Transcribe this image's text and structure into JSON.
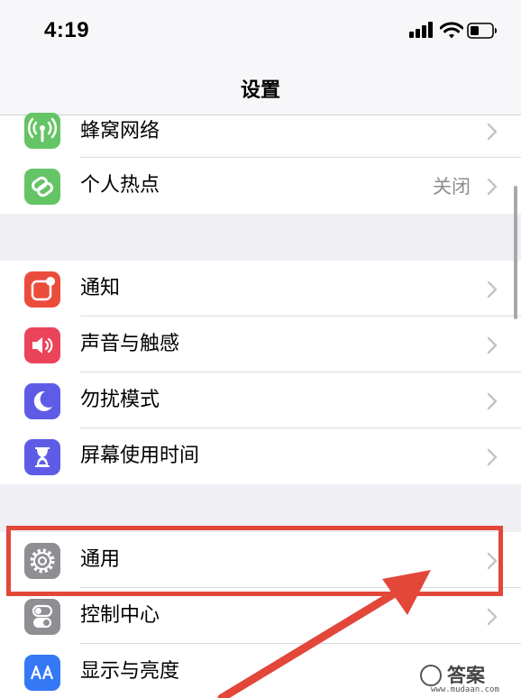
{
  "status_bar": {
    "time": "4:19"
  },
  "nav": {
    "title": "设置"
  },
  "groups": {
    "network": [
      {
        "label": "蜂窝网络",
        "icon": "cellular-antenna-icon",
        "color": "#65c466"
      },
      {
        "label": "个人热点",
        "value": "关闭",
        "icon": "hotspot-link-icon",
        "color": "#65c466"
      }
    ],
    "alerts": [
      {
        "label": "通知",
        "icon": "notifications-icon",
        "color": "#eb4d3d"
      },
      {
        "label": "声音与触感",
        "icon": "speaker-icon",
        "color": "#eb445a"
      },
      {
        "label": "勿扰模式",
        "icon": "moon-icon",
        "color": "#5e5ce6"
      },
      {
        "label": "屏幕使用时间",
        "icon": "hourglass-icon",
        "color": "#5e5ce6"
      }
    ],
    "system": [
      {
        "label": "通用",
        "icon": "gear-icon",
        "color": "#8e8e93"
      },
      {
        "label": "控制中心",
        "icon": "toggles-icon",
        "color": "#8e8e93"
      },
      {
        "label": "显示与亮度",
        "icon": "display-aa-icon",
        "color": "#3478f6"
      }
    ]
  },
  "annotation": {
    "highlight_color": "#e2473a"
  },
  "watermark": {
    "text": "答案",
    "url": "www.mudaan.com"
  }
}
